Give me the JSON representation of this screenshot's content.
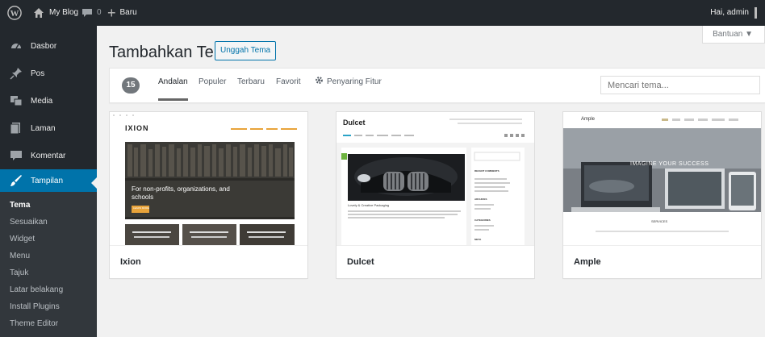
{
  "adminbar": {
    "site_name": "My Blog",
    "comment_count": "0",
    "new_label": "Baru",
    "greeting": "Hai, admin"
  },
  "sidebar": {
    "items": [
      {
        "label": "Dasbor",
        "icon": "dashboard-icon"
      },
      {
        "label": "Pos",
        "icon": "pin-icon"
      },
      {
        "label": "Media",
        "icon": "media-icon"
      },
      {
        "label": "Laman",
        "icon": "page-icon"
      },
      {
        "label": "Komentar",
        "icon": "comment-icon"
      },
      {
        "label": "Tampilan",
        "icon": "brush-icon"
      }
    ],
    "submenu": [
      "Tema",
      "Sesuaikan",
      "Widget",
      "Menu",
      "Tajuk",
      "Latar belakang",
      "Install Plugins",
      "Theme Editor"
    ]
  },
  "help_tab": "Bantuan ▼",
  "page": {
    "title": "Tambahkan Tema",
    "upload_button": "Unggah Tema"
  },
  "filter": {
    "count": "15",
    "links": [
      "Andalan",
      "Populer",
      "Terbaru",
      "Favorit"
    ],
    "feature_filter": "Penyaring Fitur",
    "search_placeholder": "Mencari tema..."
  },
  "themes": [
    {
      "name": "Ixion",
      "logo": "IXION",
      "hero_text": "For non-profits, organizations, and schools",
      "hero_button": "LEARN MORE"
    },
    {
      "name": "Dulcet",
      "logo": "Dulcet",
      "post_title": "Lovely & Creative Packaging",
      "widget_headings": [
        "RECENT COMMENTS",
        "ARCHIVES",
        "CATEGORIES",
        "META"
      ]
    },
    {
      "name": "Ample",
      "logo": "Ample",
      "hero_text": "IMAGINE YOUR SUCCESS",
      "section_title": "SERVICES"
    }
  ],
  "colors": {
    "adminbar": "#23282d",
    "active_menu": "#0073aa",
    "link": "#0073aa"
  }
}
